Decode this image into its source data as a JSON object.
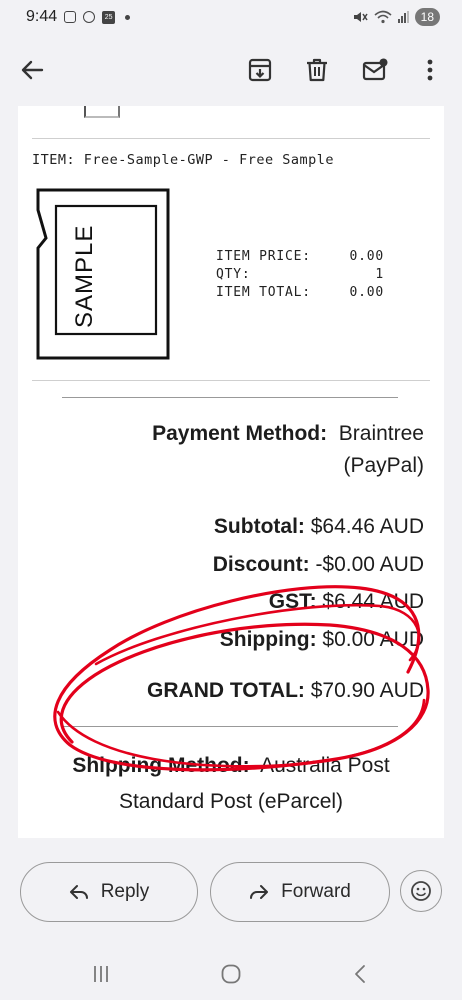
{
  "status_bar": {
    "time": "9:44",
    "calendar_day": "25",
    "battery": "18"
  },
  "app_bar": {
    "icons": [
      "back-arrow-icon",
      "archive-icon",
      "trash-icon",
      "mark-unread-icon",
      "more-vert-icon"
    ]
  },
  "email": {
    "item_line": "ITEM: Free-Sample-GWP - Free Sample",
    "sample_label": "SAMPLE",
    "item_table": [
      {
        "key": "ITEM PRICE:",
        "value": "0.00"
      },
      {
        "key": "QTY:",
        "value": "1"
      },
      {
        "key": "ITEM TOTAL:",
        "value": "0.00"
      }
    ],
    "payment": {
      "label": "Payment Method:",
      "value_line1": "Braintree",
      "value_line2": "(PayPal)"
    },
    "totals": [
      {
        "label": "Subtotal:",
        "value": "$64.46 AUD"
      },
      {
        "label": "Discount:",
        "value": "-$0.00 AUD"
      },
      {
        "label": "GST:",
        "value": "$6.44 AUD"
      },
      {
        "label": "Shipping:",
        "value": "$0.00 AUD"
      }
    ],
    "grand_total": {
      "label": "GRAND TOTAL:",
      "value": "$70.90 AUD"
    },
    "shipping_method": {
      "label": "Shipping Method:",
      "value_line1": "Australia Post",
      "value_line2": "Standard Post (eParcel)"
    },
    "annotation_color": "#e3001b"
  },
  "actions": {
    "reply_label": "Reply",
    "forward_label": "Forward"
  }
}
